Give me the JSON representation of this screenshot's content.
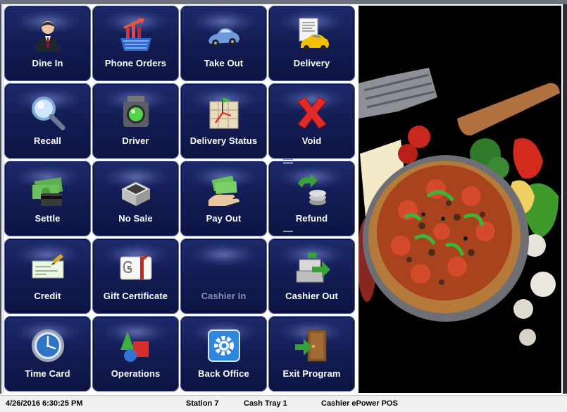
{
  "tiles": [
    {
      "label": "Dine In",
      "icon": "businessman-icon"
    },
    {
      "label": "Phone Orders",
      "icon": "shopping-basket-chart-icon"
    },
    {
      "label": "Take Out",
      "icon": "car-icon"
    },
    {
      "label": "Delivery",
      "icon": "taxi-document-icon"
    },
    {
      "label": "Recall",
      "icon": "magnifier-icon"
    },
    {
      "label": "Driver",
      "icon": "traffic-light-icon"
    },
    {
      "label": "Delivery Status",
      "icon": "map-flag-icon"
    },
    {
      "label": "Void",
      "icon": "red-x-icon"
    },
    {
      "label": "Settle",
      "icon": "cash-card-icon"
    },
    {
      "label": "No Sale",
      "icon": "cash-drawer-icon"
    },
    {
      "label": "Pay Out",
      "icon": "hand-money-icon"
    },
    {
      "label": "Refund",
      "icon": "coins-arrow-icon"
    },
    {
      "label": "Credit",
      "icon": "credit-slip-icon"
    },
    {
      "label": "Gift Certificate",
      "icon": "gift-card-icon"
    },
    {
      "label": "Cashier In",
      "icon": "none",
      "disabled": true
    },
    {
      "label": "Cashier Out",
      "icon": "register-arrow-icon"
    },
    {
      "label": "Time Card",
      "icon": "clock-icon"
    },
    {
      "label": "Operations",
      "icon": "shapes-icon"
    },
    {
      "label": "Back Office",
      "icon": "settings-gear-icon"
    },
    {
      "label": "Exit Program",
      "icon": "exit-door-icon"
    }
  ],
  "side_image": {
    "subject": "pizza-photo"
  },
  "status": {
    "datetime": "4/26/2016 6:30:25 PM",
    "station": "Station 7",
    "cash_tray": "Cash Tray 1",
    "cashier": "Cashier ePower POS"
  },
  "colors": {
    "tile_top": "#1d2a6a",
    "tile_bottom": "#0d1443",
    "label": "#ffffff",
    "disabled_label": "#8a90b0"
  }
}
